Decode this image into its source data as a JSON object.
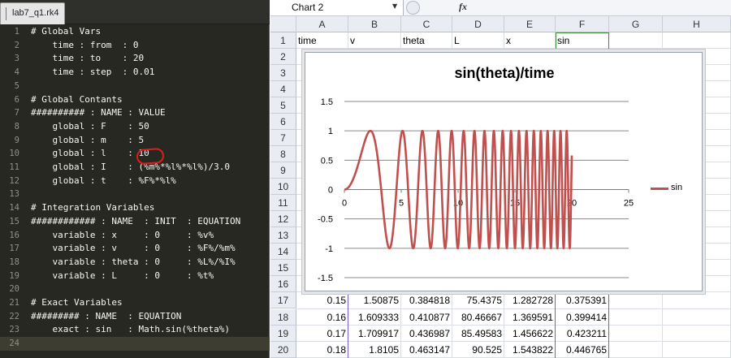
{
  "editor": {
    "tab_label": "lab7_q1.rk4",
    "current_line": 24,
    "lines": [
      "# Global Vars",
      "    time : from  : 0",
      "    time : to    : 20",
      "    time : step  : 0.01",
      "",
      "# Global Contants",
      "########## : NAME : VALUE",
      "    global : F    : 50",
      "    global : m    : 5",
      "    global : l    : 10",
      "    global : I    : (%m%*%l%*%l%)/3.0",
      "    global : t    : %F%*%l%",
      "",
      "# Integration Variables",
      "############ : NAME  : INIT  : EQUATION",
      "    variable : x     : 0     : %v%",
      "    variable : v     : 0     : %F%/%m%",
      "    variable : theta : 0     : %L%/%I%",
      "    variable : L     : 0     : %t%",
      "",
      "# Exact Variables",
      "######### : NAME  : EQUATION",
      "    exact : sin   : Math.sin(%theta%)",
      ""
    ]
  },
  "sheet": {
    "name_box": "Chart 2",
    "fx_label": "fx",
    "columns": [
      "A",
      "B",
      "C",
      "D",
      "E",
      "F",
      "G",
      "H"
    ],
    "rows": [
      "1",
      "2",
      "3",
      "4",
      "5",
      "6",
      "7",
      "8",
      "9",
      "10",
      "11",
      "12",
      "13",
      "14",
      "15",
      "16",
      "17",
      "18",
      "19",
      "20"
    ],
    "header_row": [
      "time",
      "v",
      "theta",
      "L",
      "x",
      "sin"
    ],
    "data_rows": [
      [
        "0.15",
        "1.50875",
        "0.384818",
        "75.4375",
        "1.282728",
        "0.375391"
      ],
      [
        "0.16",
        "1.609333",
        "0.410877",
        "80.46667",
        "1.369591",
        "0.399414"
      ],
      [
        "0.17",
        "1.709917",
        "0.436987",
        "85.49583",
        "1.456622",
        "0.423211"
      ],
      [
        "0.18",
        "1.8105",
        "0.463147",
        "90.525",
        "1.543822",
        "0.446765"
      ]
    ],
    "colors": {
      "series": "#c0504d",
      "selection": "#7a5fc6"
    }
  },
  "chart_data": {
    "type": "line",
    "title": "sin(theta)/time",
    "xlabel": "",
    "ylabel": "",
    "xlim": [
      0,
      25
    ],
    "ylim": [
      -1.5,
      1.5
    ],
    "xticks": [
      "0",
      "5",
      "10",
      "15",
      "20",
      "25"
    ],
    "yticks": [
      "1.5",
      "1",
      "0.5",
      "0",
      "-0.5",
      "-1",
      "-1.5"
    ],
    "grid": "horizontal",
    "legend": "right",
    "series": [
      {
        "name": "sin",
        "function": "sin(0.3*t^2)",
        "x_range": [
          0,
          20
        ],
        "color": "#c0504d"
      }
    ]
  }
}
